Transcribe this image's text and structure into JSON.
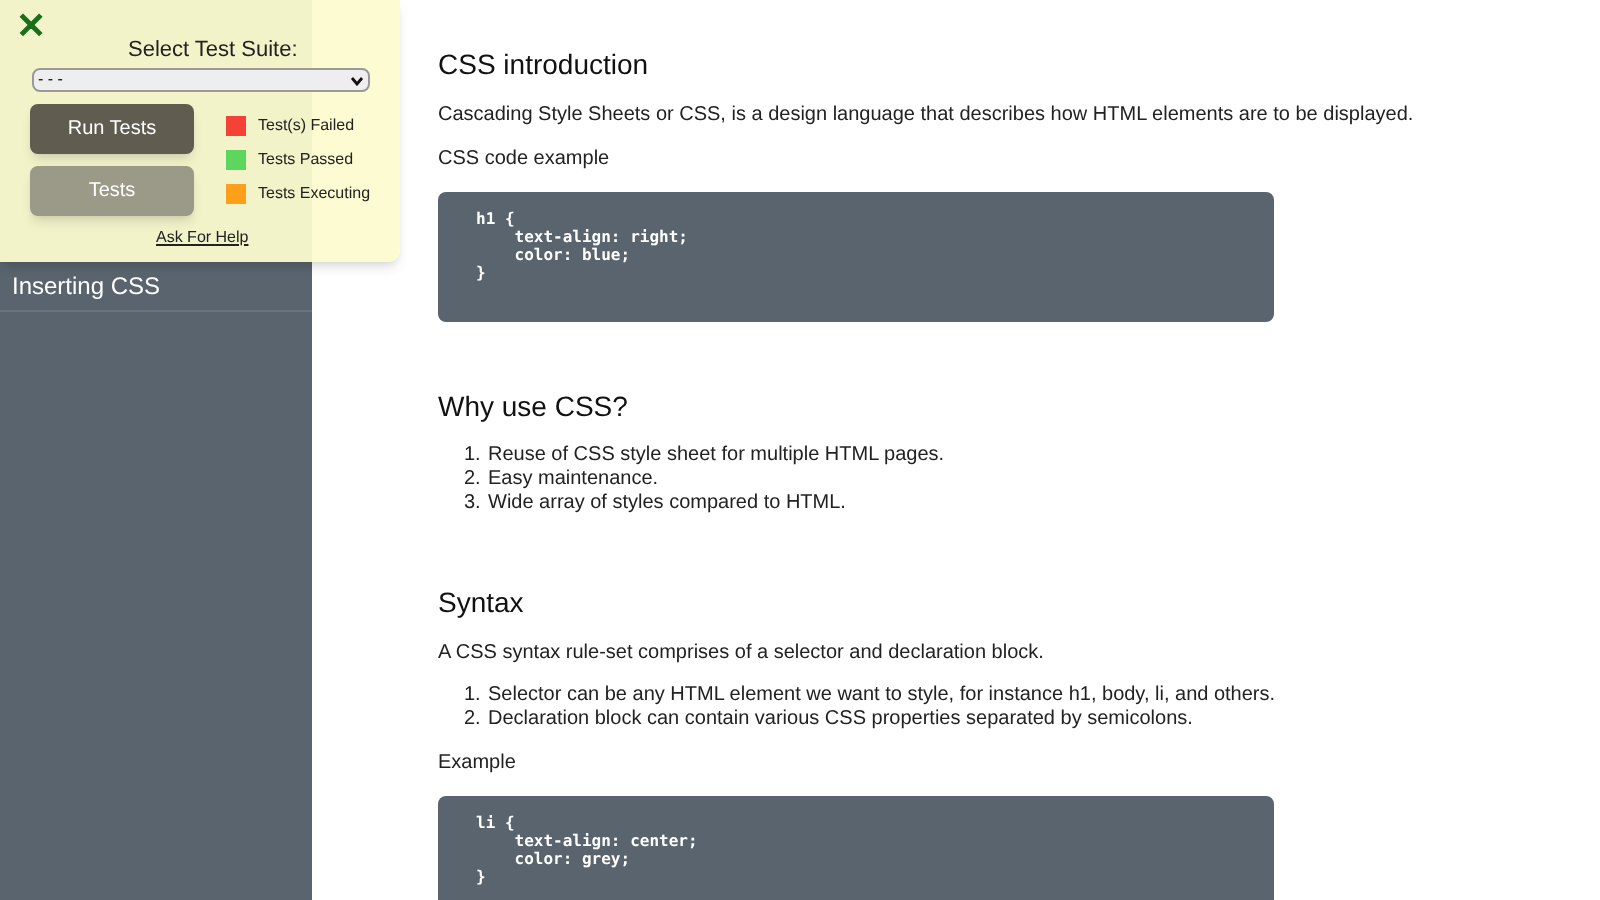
{
  "sidebar": {
    "items": [
      {
        "label": "Inserting CSS"
      }
    ]
  },
  "test_panel": {
    "close_icon": "✕",
    "title": "Select Test Suite:",
    "select_value": "- - -",
    "buttons": [
      {
        "label": "Run Tests",
        "kind": "primary"
      },
      {
        "label": "Tests",
        "kind": "secondary"
      }
    ],
    "legend": [
      {
        "label": "Test(s) Failed",
        "color": "#f44336"
      },
      {
        "label": "Tests Passed",
        "color": "#5cd65c"
      },
      {
        "label": "Tests Executing",
        "color": "#ff9f1a"
      }
    ],
    "help_link": "Ask For Help"
  },
  "sections": [
    {
      "heading": "CSS introduction",
      "blocks": [
        {
          "kind": "para",
          "text": "Cascading Style Sheets or CSS, is a design language that describes how HTML elements are to be displayed."
        },
        {
          "kind": "para",
          "text": "CSS code example"
        },
        {
          "kind": "code",
          "text": "h1 {\n    text-align: right;\n    color: blue;\n}"
        }
      ]
    },
    {
      "heading": "Why use CSS?",
      "blocks": [
        {
          "kind": "list",
          "items": [
            {
              "number": "1.",
              "text": "Reuse of CSS style sheet for multiple HTML pages."
            },
            {
              "number": "2.",
              "text": "Easy maintenance."
            },
            {
              "number": "3.",
              "text": "Wide array of styles compared to HTML."
            }
          ]
        }
      ]
    },
    {
      "heading": "Syntax",
      "blocks": [
        {
          "kind": "para",
          "text": "A CSS syntax rule-set comprises of a selector and declaration block."
        },
        {
          "kind": "list",
          "items": [
            {
              "number": "1.",
              "text": "Selector can be any HTML element we want to style, for instance h1, body, li, and others."
            },
            {
              "number": "2.",
              "text": "Declaration block can contain various CSS properties separated by semicolons."
            }
          ]
        },
        {
          "kind": "para",
          "text": "Example"
        },
        {
          "kind": "code",
          "text": "li {\n    text-align: center;\n    color: grey;\n}"
        }
      ]
    }
  ]
}
